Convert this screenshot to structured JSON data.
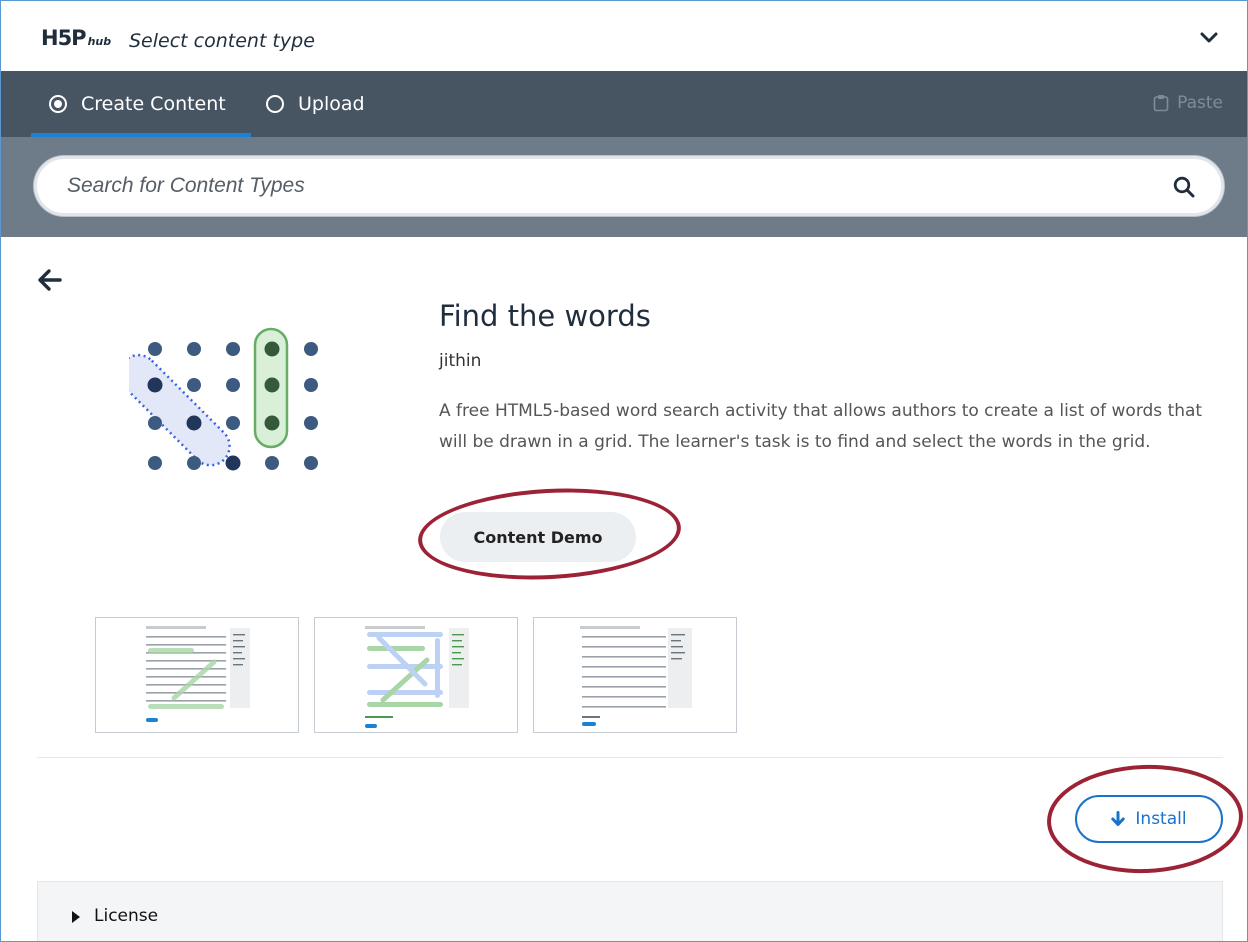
{
  "header": {
    "logo_main": "H5P",
    "logo_sub": "hub",
    "title": "Select content type"
  },
  "tabs": [
    {
      "label": "Create Content",
      "selected": true
    },
    {
      "label": "Upload",
      "selected": false
    }
  ],
  "paste_label": "Paste",
  "search": {
    "placeholder": "Search for Content Types",
    "value": ""
  },
  "detail": {
    "title": "Find the words",
    "owner": "jithin",
    "description": "A free HTML5-based word search activity that allows authors to create a list of words that will be drawn in a grid. The learner's task is to find and select the words in the grid.",
    "demo_label": "Content Demo",
    "install_label": "Install"
  },
  "license": {
    "label": "License"
  },
  "colors": {
    "tabbar": "#475563",
    "searchbar": "#6e7b89",
    "accent": "#1a73c9",
    "annotation_ring": "#9b2335"
  }
}
